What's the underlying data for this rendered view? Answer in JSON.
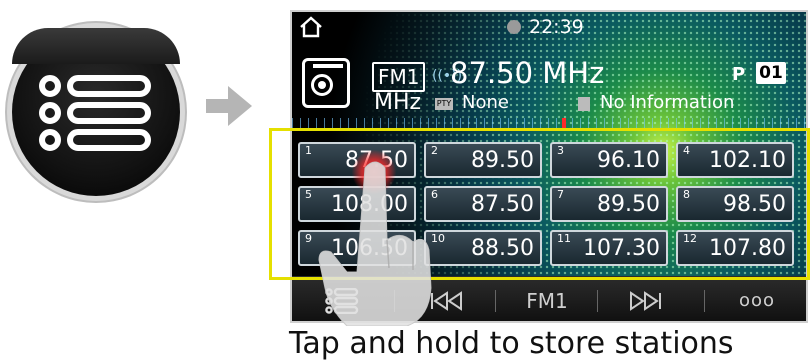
{
  "app_menu_icon": "list-menu-icon",
  "arrow_icon": "arrow-right-icon",
  "status": {
    "time": "22:39"
  },
  "tuner": {
    "band": "FM1",
    "unit": "MHz",
    "frequency": "87.50 MHz",
    "pty_label": "None",
    "info_label": "No Information",
    "preset_prefix": "P",
    "preset_number": "01"
  },
  "presets": [
    {
      "number": "1",
      "value": "87.50"
    },
    {
      "number": "2",
      "value": "89.50"
    },
    {
      "number": "3",
      "value": "96.10"
    },
    {
      "number": "4",
      "value": "102.10"
    },
    {
      "number": "5",
      "value": "108.00"
    },
    {
      "number": "6",
      "value": "87.50"
    },
    {
      "number": "7",
      "value": "89.50"
    },
    {
      "number": "8",
      "value": "98.50"
    },
    {
      "number": "9",
      "value": "106.50"
    },
    {
      "number": "10",
      "value": "88.50"
    },
    {
      "number": "11",
      "value": "107.30"
    },
    {
      "number": "12",
      "value": "107.80"
    }
  ],
  "bottom_bar": {
    "band_label": "FM1",
    "more_label": "ooo"
  },
  "caption": "Tap and hold to store stations",
  "colors": {
    "highlight": "#e5e000",
    "touch": "#ff3030",
    "tuning_pointer": "#ff2a2a"
  }
}
